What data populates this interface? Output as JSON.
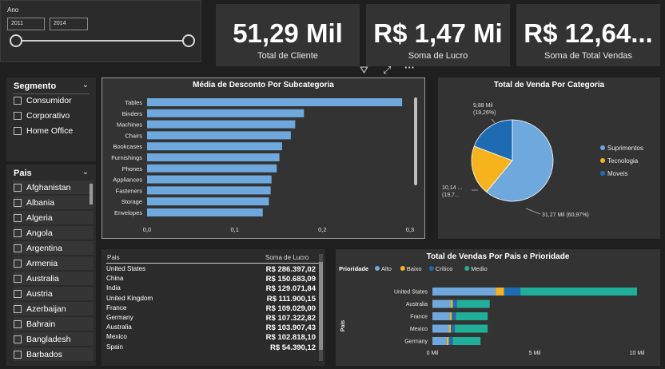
{
  "year_slicer": {
    "title": "Ano",
    "start": "2011",
    "end": "2014"
  },
  "kpis": [
    {
      "value": "51,29 Mil",
      "label": "Total de Cliente"
    },
    {
      "value": "R$ 1,47 Mi",
      "label": "Soma de Lucro"
    },
    {
      "value": "R$ 12,64...",
      "label": "Soma de Total Vendas"
    }
  ],
  "toolbar": {
    "filter_icon": "filter-icon",
    "focus_icon": "focus-mode-icon",
    "more_icon": "more-options-icon",
    "filter_glyph": "⛛",
    "focus_glyph": "⤢",
    "more_glyph": "···"
  },
  "segment_slicer": {
    "title": "Segmento",
    "items": [
      "Consumidor",
      "Corporativo",
      "Home Office"
    ]
  },
  "pais_slicer": {
    "title": "Pais",
    "items": [
      "Afghanistan",
      "Albania",
      "Algeria",
      "Angola",
      "Argentina",
      "Armenia",
      "Australia",
      "Austria",
      "Azerbaijan",
      "Bahrain",
      "Bangladesh",
      "Barbados"
    ]
  },
  "chart_data": [
    {
      "type": "bar",
      "title": "Média de Desconto Por Subcategoria",
      "categories": [
        "Tables",
        "Binders",
        "Machines",
        "Chairs",
        "Bookcases",
        "Furnishings",
        "Phones",
        "Appliances",
        "Fasteners",
        "Storage",
        "Envelopes"
      ],
      "values": [
        0.291,
        0.179,
        0.169,
        0.164,
        0.154,
        0.151,
        0.148,
        0.142,
        0.141,
        0.139,
        0.132
      ],
      "xlim": [
        0,
        0.3
      ],
      "xticks": [
        "0,0",
        "0,1",
        "0,2",
        "0,3"
      ],
      "color": "#6fa8dc"
    },
    {
      "type": "pie",
      "title": "Total de Venda Por Categoria",
      "categories": [
        "Suprimentos",
        "Tecnologia",
        "Moveis"
      ],
      "values": [
        31.27,
        10.14,
        9.88
      ],
      "percents": [
        60.97,
        19.77,
        19.26
      ],
      "labels": [
        "31,27 Mil (60,97%)",
        "10,14 ...\n(19,7...",
        "9,88 Mil\n(19,26%)"
      ],
      "colors": [
        "#6fa8dc",
        "#f6b31c",
        "#1f6bb3"
      ]
    },
    {
      "type": "table",
      "columns": [
        "Pais",
        "Soma de Lucro"
      ],
      "rows": [
        [
          "United States",
          "R$ 286.397,02"
        ],
        [
          "China",
          "R$ 150.683,09"
        ],
        [
          "India",
          "R$ 129.071,84"
        ],
        [
          "United Kingdom",
          "R$ 111.900,15"
        ],
        [
          "France",
          "R$ 109.029,00"
        ],
        [
          "Germany",
          "R$ 107.322,82"
        ],
        [
          "Australia",
          "R$ 103.907,43"
        ],
        [
          "Mexico",
          "R$ 102.818,10"
        ],
        [
          "Spain",
          "R$ 54.390,12"
        ]
      ]
    },
    {
      "type": "bar",
      "stacked": true,
      "orientation": "horizontal",
      "title": "Total de Vendas Por Pais e Prioridade",
      "legend_title": "Prioridade",
      "ylabel": "Pais",
      "categories": [
        "United States",
        "Australia",
        "France",
        "Mexico",
        "Germany"
      ],
      "series": [
        {
          "name": "Alto",
          "color": "#6fa8dc",
          "values": [
            3.1,
            0.9,
            0.85,
            0.8,
            0.7
          ]
        },
        {
          "name": "Baixo",
          "color": "#f6b31c",
          "values": [
            0.4,
            0.1,
            0.1,
            0.1,
            0.1
          ]
        },
        {
          "name": "Crítico",
          "color": "#1f6bb3",
          "values": [
            0.8,
            0.2,
            0.2,
            0.2,
            0.2
          ]
        },
        {
          "name": "Medio",
          "color": "#20b09a",
          "values": [
            5.7,
            1.6,
            1.55,
            1.6,
            1.35
          ]
        }
      ],
      "xlim": [
        0,
        10
      ],
      "xticks": [
        "0 Mil",
        "5 Mil",
        "10 Mil"
      ]
    }
  ]
}
